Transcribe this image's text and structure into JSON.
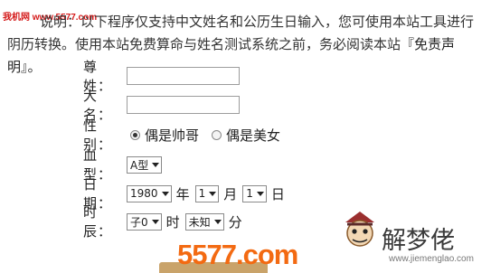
{
  "watermark_top": "我机网 www.5577.com",
  "notice": {
    "text_before": "说明：以下程序仅支持中文姓名和公历生日输入，您可使用本站工具进行阴历转换。使用本站免费算命与姓名测试系统之前，务必阅读本站",
    "link": "『免责声明』",
    "text_after": "。"
  },
  "form": {
    "surname_label": "尊 姓：",
    "surname_value": "",
    "name_label": "大 名：",
    "name_value": "",
    "gender_label": "性 别：",
    "gender_male": "偶是帅哥",
    "gender_female": "偶是美女",
    "gender_selected": "male",
    "blood_label": "血 型：",
    "blood_value": "A型",
    "date_label": "日 期：",
    "year_value": "1980",
    "year_unit": "年",
    "month_value": "1",
    "month_unit": "月",
    "day_value": "1",
    "day_unit": "日",
    "time_label": "时 辰：",
    "hour_value": "子0",
    "hour_unit": "时",
    "minute_value": "未知",
    "minute_unit": "分"
  },
  "watermark_bottom": {
    "brand": "5577.com",
    "brand2": "解梦佬",
    "brand2_url": "www.jiemenglao.com",
    "colors": {
      "orange": "#f36a12",
      "red": "#d41a1a"
    }
  }
}
